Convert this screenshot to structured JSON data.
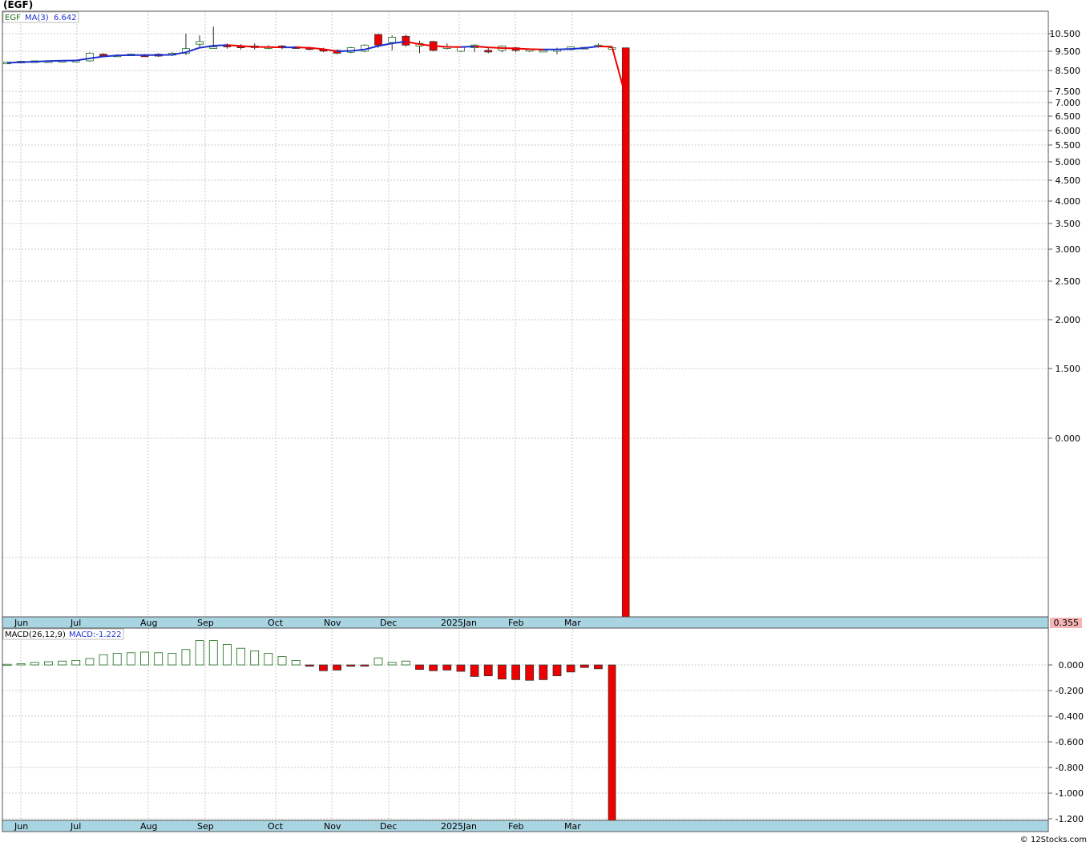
{
  "header": {
    "title": "(EGF)"
  },
  "price_panel": {
    "legend_symbol": "EGF",
    "legend_ma": "MA(3)",
    "legend_ma_value": "6.642",
    "last_value_badge": "0.355"
  },
  "macd_panel": {
    "legend_name": "MACD(26,12,9)",
    "legend_value": "MACD:-1.222"
  },
  "footer": {
    "credit": "© 12Stocks.com"
  },
  "colors": {
    "up": "#1a6b1a",
    "down": "#ee0000",
    "ma_up": "#1f2fd0",
    "ma_down": "#ee0000",
    "grid": "#c8c8c8",
    "axis_band": "#a9d4e2",
    "badge": "#f5b5b5"
  },
  "chart_data": [
    {
      "type": "candlestick",
      "x_tick_labels": [
        "Jun",
        "Jul",
        "Aug",
        "Sep",
        "Oct",
        "Nov",
        "Dec",
        "2025Jan",
        "Feb",
        "Mar"
      ],
      "y_tick_labels": [
        "10.500",
        "9.500",
        "8.500",
        "7.500",
        "7.000",
        "6.500",
        "6.000",
        "5.500",
        "5.000",
        "4.500",
        "4.000",
        "3.500",
        "3.000",
        "2.500",
        "2.000",
        "1.500",
        "0.000"
      ],
      "scale": "compressed (non-linear)",
      "grid": true,
      "series": [
        {
          "name": "EGF",
          "candles": [
            {
              "o": 8.9,
              "c": 8.93,
              "h": 8.96,
              "l": 8.88
            },
            {
              "o": 8.96,
              "c": 8.98,
              "h": 9.0,
              "l": 8.94
            },
            {
              "o": 9.0,
              "c": 9.0,
              "h": 9.02,
              "l": 8.98
            },
            {
              "o": 9.0,
              "c": 9.0,
              "h": 9.02,
              "l": 8.98
            },
            {
              "o": 9.02,
              "c": 9.02,
              "h": 9.04,
              "l": 9.0
            },
            {
              "o": 9.03,
              "c": 9.03,
              "h": 9.05,
              "l": 9.01
            },
            {
              "o": 9.0,
              "c": 9.4,
              "h": 9.45,
              "l": 8.96
            },
            {
              "o": 9.35,
              "c": 9.3,
              "h": 9.4,
              "l": 9.25
            },
            {
              "o": 9.3,
              "c": 9.3,
              "h": 9.35,
              "l": 9.25
            },
            {
              "o": 9.3,
              "c": 9.35,
              "h": 9.38,
              "l": 9.25
            },
            {
              "o": 9.3,
              "c": 9.28,
              "h": 9.36,
              "l": 9.22
            },
            {
              "o": 9.35,
              "c": 9.25,
              "h": 9.4,
              "l": 9.2
            },
            {
              "o": 9.3,
              "c": 9.4,
              "h": 9.45,
              "l": 9.25
            },
            {
              "o": 9.4,
              "c": 9.65,
              "h": 10.5,
              "l": 9.3
            },
            {
              "o": 9.9,
              "c": 10.05,
              "h": 10.4,
              "l": 9.75
            },
            {
              "o": 9.7,
              "c": 9.75,
              "h": 10.9,
              "l": 9.68
            },
            {
              "o": 9.85,
              "c": 9.75,
              "h": 9.95,
              "l": 9.65
            },
            {
              "o": 9.8,
              "c": 9.7,
              "h": 9.9,
              "l": 9.6
            },
            {
              "o": 9.8,
              "c": 9.72,
              "h": 9.95,
              "l": 9.6
            },
            {
              "o": 9.7,
              "c": 9.75,
              "h": 9.85,
              "l": 9.62
            },
            {
              "o": 9.8,
              "c": 9.7,
              "h": 9.85,
              "l": 9.62
            },
            {
              "o": 9.75,
              "c": 9.72,
              "h": 9.8,
              "l": 9.65
            },
            {
              "o": 9.7,
              "c": 9.65,
              "h": 9.75,
              "l": 9.55
            },
            {
              "o": 9.6,
              "c": 9.55,
              "h": 9.7,
              "l": 9.45
            },
            {
              "o": 9.55,
              "c": 9.4,
              "h": 9.6,
              "l": 9.35
            },
            {
              "o": 9.45,
              "c": 9.7,
              "h": 9.75,
              "l": 9.4
            },
            {
              "o": 9.5,
              "c": 9.85,
              "h": 9.9,
              "l": 9.45
            },
            {
              "o": 10.45,
              "c": 9.85,
              "h": 10.5,
              "l": 9.7
            },
            {
              "o": 10.0,
              "c": 10.3,
              "h": 10.4,
              "l": 9.55
            },
            {
              "o": 10.35,
              "c": 9.85,
              "h": 10.45,
              "l": 9.75
            },
            {
              "o": 9.8,
              "c": 9.95,
              "h": 10.1,
              "l": 9.4
            },
            {
              "o": 10.05,
              "c": 9.55,
              "h": 10.1,
              "l": 9.5
            },
            {
              "o": 9.7,
              "c": 9.75,
              "h": 9.95,
              "l": 9.6
            },
            {
              "o": 9.5,
              "c": 9.75,
              "h": 9.8,
              "l": 9.45
            },
            {
              "o": 9.7,
              "c": 9.85,
              "h": 9.9,
              "l": 9.45
            },
            {
              "o": 9.55,
              "c": 9.5,
              "h": 9.7,
              "l": 9.4
            },
            {
              "o": 9.55,
              "c": 9.8,
              "h": 9.85,
              "l": 9.45
            },
            {
              "o": 9.7,
              "c": 9.55,
              "h": 9.75,
              "l": 9.45
            },
            {
              "o": 9.55,
              "c": 9.6,
              "h": 9.65,
              "l": 9.45
            },
            {
              "o": 9.55,
              "c": 9.55,
              "h": 9.6,
              "l": 9.5
            },
            {
              "o": 9.5,
              "c": 9.6,
              "h": 9.7,
              "l": 9.35
            },
            {
              "o": 9.6,
              "c": 9.75,
              "h": 9.78,
              "l": 9.55
            },
            {
              "o": 9.7,
              "c": 9.72,
              "h": 9.76,
              "l": 9.62
            },
            {
              "o": 9.8,
              "c": 9.85,
              "h": 9.95,
              "l": 9.7
            },
            {
              "o": 9.7,
              "c": 9.7,
              "h": 9.8,
              "l": 9.62
            },
            {
              "o": 9.7,
              "c": 0.355,
              "h": 9.7,
              "l": 0.355
            }
          ]
        },
        {
          "name": "MA(3)",
          "values": [
            8.9,
            8.93,
            8.96,
            8.99,
            9.01,
            9.02,
            9.13,
            9.23,
            9.28,
            9.3,
            9.3,
            9.3,
            9.32,
            9.45,
            9.7,
            9.82,
            9.85,
            9.8,
            9.75,
            9.74,
            9.72,
            9.72,
            9.7,
            9.62,
            9.5,
            9.52,
            9.6,
            9.8,
            9.95,
            10.05,
            9.9,
            9.8,
            9.75,
            9.74,
            9.78,
            9.72,
            9.68,
            9.66,
            9.62,
            9.6,
            9.6,
            9.63,
            9.68,
            9.78,
            9.76,
            7.25
          ]
        }
      ]
    },
    {
      "type": "bar",
      "series_name": "MACD(26,12,9)",
      "x_tick_labels": [
        "Jun",
        "Jul",
        "Aug",
        "Sep",
        "Oct",
        "Nov",
        "Dec",
        "2025Jan",
        "Feb",
        "Mar"
      ],
      "y_tick_labels": [
        "0.000",
        "-0.200",
        "-0.400",
        "-0.600",
        "-0.800",
        "-1.000",
        "-1.200"
      ],
      "ylim": [
        -1.222,
        0.2
      ],
      "grid": true,
      "values": [
        0.005,
        0.01,
        0.02,
        0.025,
        0.03,
        0.035,
        0.05,
        0.08,
        0.09,
        0.095,
        0.1,
        0.095,
        0.09,
        0.12,
        0.19,
        0.19,
        0.16,
        0.13,
        0.11,
        0.09,
        0.065,
        0.035,
        -0.01,
        -0.045,
        -0.04,
        -0.01,
        -0.005,
        0.055,
        0.02,
        0.03,
        -0.035,
        -0.045,
        -0.04,
        -0.05,
        -0.09,
        -0.085,
        -0.11,
        -0.115,
        -0.12,
        -0.115,
        -0.085,
        -0.055,
        -0.02,
        -0.03,
        -1.222
      ]
    }
  ]
}
